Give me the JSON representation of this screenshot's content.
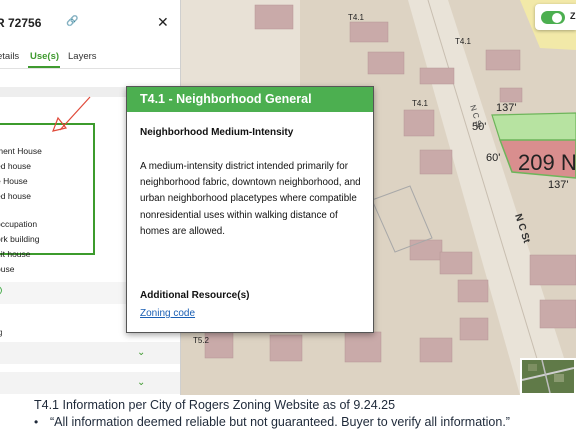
{
  "panel": {
    "title": "R 72756",
    "tabs": [
      {
        "label": "etails"
      },
      {
        "label": "Use(s)"
      },
      {
        "label": "Layers"
      }
    ],
    "uses": [
      "ment House",
      "ed house",
      "e House",
      "ed house",
      "occupation",
      "ork building",
      "nit house",
      "ouse"
    ],
    "bottom_label": "g"
  },
  "popup": {
    "title": "T4.1 - Neighborhood General",
    "subtitle": "Neighborhood Medium-Intensity",
    "description": "A medium-intensity district intended primarily for neighborhood fabric, downtown neighborhood, and urban neighborhood placetypes where compatible nonresidential uses within walking distance of homes are allowed.",
    "resources_heading": "Additional Resource(s)",
    "link_label": "Zoning code"
  },
  "map": {
    "labels": {
      "zone_top": "T4.1",
      "zone_mid": "T4.1",
      "zone_left": "T4.1",
      "zone_bottom": "T5.2",
      "street_upper": "N C St",
      "street_lower": "N C St",
      "parcel_number": "209 N",
      "dim_137_top": "137'",
      "dim_137_bottom": "137'",
      "dim_50": "50'",
      "dim_60": "60'"
    },
    "toggle_label": "Z",
    "colors": {
      "accent": "#4caf50",
      "parcel": "#d98e8e",
      "highlight": "#b7e3a1"
    }
  },
  "caption": {
    "line1": "T4.1 Information per City of Rogers Zoning Website as of  9.24.25",
    "line2": "“All information deemed reliable but not guaranteed. Buyer to verify all information.”"
  }
}
